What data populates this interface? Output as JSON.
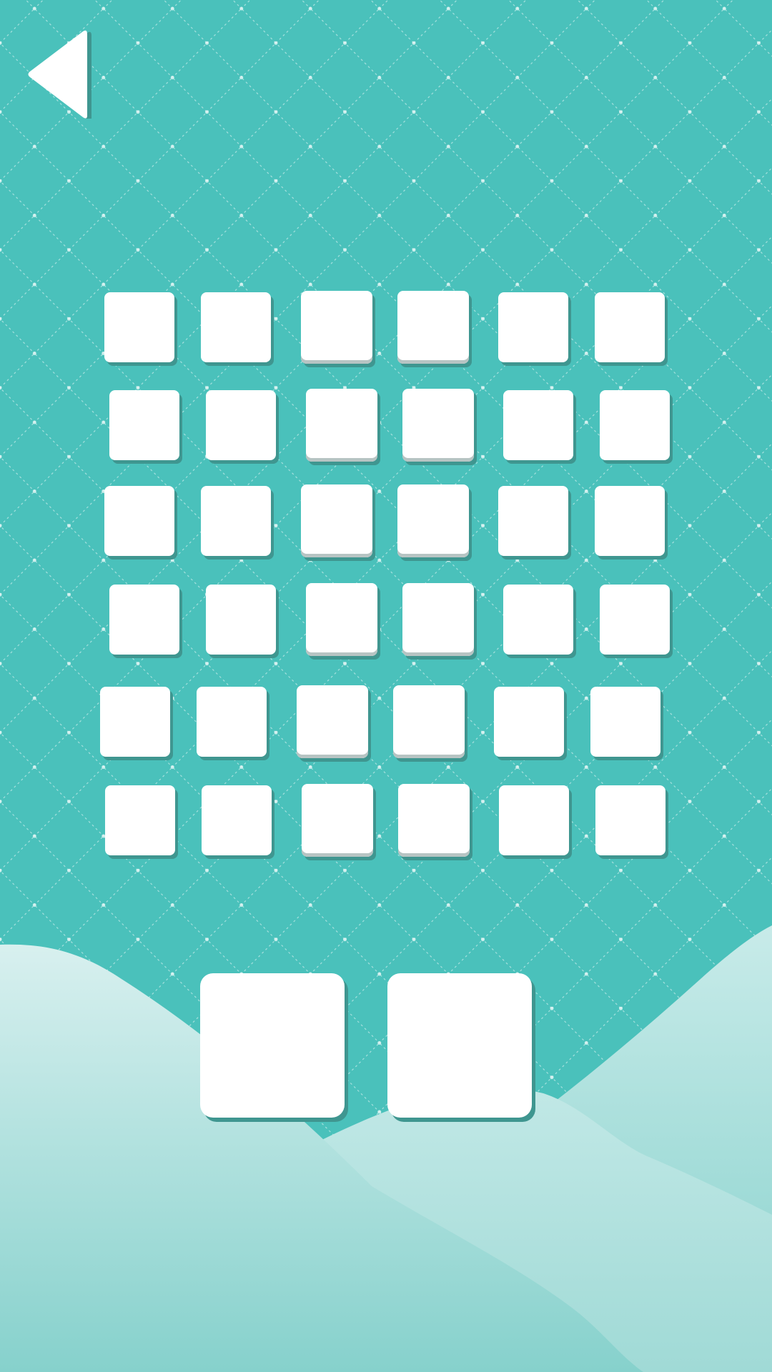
{
  "screen": {
    "colors": {
      "background": "#4ac1bb",
      "pattern": "#ffffff",
      "hill_light": "#d8f0ef",
      "hill_mid": "#a6dcd9",
      "hill_front": "#86d1cc",
      "tile": "#ffffff",
      "tile_shadow": "#3f9690"
    },
    "back_button": {
      "icon": "left-triangle-icon"
    },
    "level_grid": {
      "rows": 6,
      "columns": 6,
      "levels": [
        {
          "id": 1
        },
        {
          "id": 2
        },
        {
          "id": 3
        },
        {
          "id": 4
        },
        {
          "id": 5
        },
        {
          "id": 6
        },
        {
          "id": 7
        },
        {
          "id": 8
        },
        {
          "id": 9
        },
        {
          "id": 10
        },
        {
          "id": 11
        },
        {
          "id": 12
        },
        {
          "id": 13
        },
        {
          "id": 14
        },
        {
          "id": 15
        },
        {
          "id": 16
        },
        {
          "id": 17
        },
        {
          "id": 18
        },
        {
          "id": 19
        },
        {
          "id": 20
        },
        {
          "id": 21
        },
        {
          "id": 22
        },
        {
          "id": 23
        },
        {
          "id": 24
        },
        {
          "id": 25
        },
        {
          "id": 26
        },
        {
          "id": 27
        },
        {
          "id": 28
        },
        {
          "id": 29
        },
        {
          "id": 30
        },
        {
          "id": 31
        },
        {
          "id": 32
        },
        {
          "id": 33
        },
        {
          "id": 34
        },
        {
          "id": 35
        },
        {
          "id": 36
        }
      ]
    },
    "bottom_buttons": [
      {
        "id": "left"
      },
      {
        "id": "right"
      }
    ]
  }
}
